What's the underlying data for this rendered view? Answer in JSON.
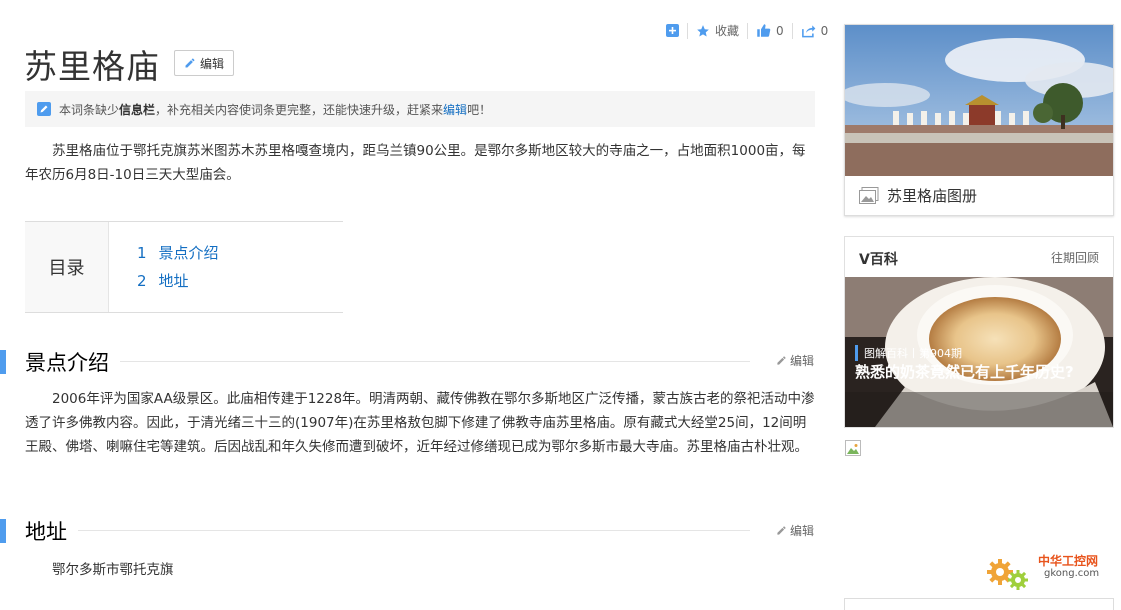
{
  "toolbar": {
    "add_icon": "plus-square-icon",
    "favorite_label": "收藏",
    "like_count": "0",
    "share_count": "0"
  },
  "page": {
    "title": "苏里格庙",
    "edit_label": "编辑"
  },
  "notice": {
    "text_before": "本词条缺少",
    "bold": "信息栏",
    "text_middle": "，补充相关内容使词条更完整，还能快速升级，赶紧来",
    "link": "编辑",
    "text_after": "吧！"
  },
  "summary": "苏里格庙位于鄂托克旗苏米图苏木苏里格嘎查境内，距乌兰镇90公里。是鄂尔多斯地区较大的寺庙之一，占地面积1000亩，每年农历6月8日-10日三天大型庙会。",
  "toc": {
    "label": "目录",
    "items": [
      {
        "num": "1",
        "label": "景点介绍"
      },
      {
        "num": "2",
        "label": "地址"
      }
    ]
  },
  "sections": [
    {
      "title": "景点介绍",
      "edit_label": "编辑",
      "body": "2006年评为国家AA级景区。此庙相传建于1228年。明清两朝、藏传佛教在鄂尔多斯地区广泛传播，蒙古族古老的祭祀活动中渗透了许多佛教内容。因此，于清光绪三十三的(1907年)在苏里格敖包脚下修建了佛教寺庙苏里格庙。原有藏式大经堂25间，12间明王殿、佛塔、喇嘛住宅等建筑。后因战乱和年久失修而遭到破坏，近年经过修缮现已成为鄂尔多斯市最大寺庙。苏里格庙古朴壮观。"
    },
    {
      "title": "地址",
      "edit_label": "编辑",
      "body": "鄂尔多斯市鄂托克旗"
    }
  ],
  "sidebar": {
    "album_caption": "苏里格庙图册",
    "vbaike": {
      "title": "V百科",
      "more": "往期回顾",
      "tag": "图解百科丨第904期",
      "caption": "熟悉的奶茶竟然已有上千年历史?"
    }
  },
  "watermark": {
    "line1": "中华工控网",
    "line2": "gkong.com"
  },
  "colors": {
    "accent": "#4f9cee",
    "link": "#136ec2"
  }
}
